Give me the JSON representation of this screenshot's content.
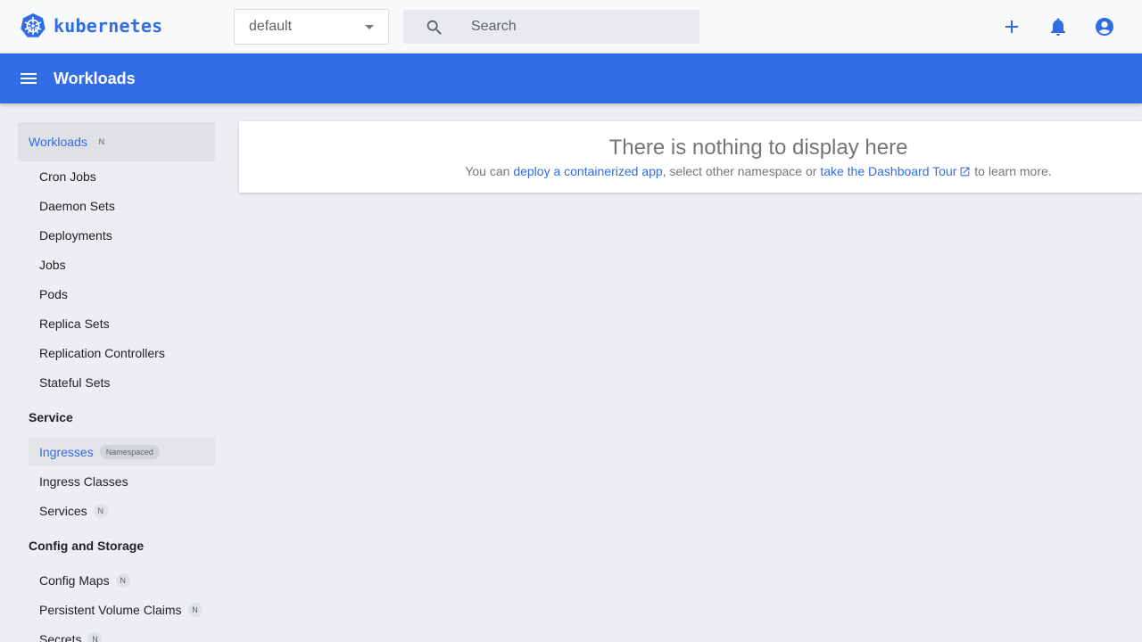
{
  "app": {
    "name": "kubernetes",
    "brand_color": "#326ce5"
  },
  "header": {
    "namespace": {
      "selected": "default"
    },
    "search": {
      "placeholder": "Search"
    },
    "icons": [
      "search-icon",
      "plus-icon",
      "bell-icon",
      "account-circle-icon"
    ]
  },
  "toolbar": {
    "title": "Workloads",
    "icon": "menu-icon"
  },
  "sidebar": {
    "workloads_header": {
      "label": "Workloads",
      "badge": "N"
    },
    "workloads_items": [
      {
        "label": "Cron Jobs"
      },
      {
        "label": "Daemon Sets"
      },
      {
        "label": "Deployments"
      },
      {
        "label": "Jobs"
      },
      {
        "label": "Pods"
      },
      {
        "label": "Replica Sets"
      },
      {
        "label": "Replication Controllers"
      },
      {
        "label": "Stateful Sets"
      }
    ],
    "service_section": "Service",
    "service_items": [
      {
        "label": "Ingresses",
        "badge": "Namespaced",
        "active": true
      },
      {
        "label": "Ingress Classes"
      },
      {
        "label": "Services",
        "badge": "N"
      }
    ],
    "config_section": "Config and Storage",
    "config_items": [
      {
        "label": "Config Maps",
        "badge": "N"
      },
      {
        "label": "Persistent Volume Claims",
        "badge": "N"
      },
      {
        "label": "Secrets",
        "badge": "N"
      }
    ]
  },
  "main": {
    "empty_title": "There is nothing to display here",
    "empty_prefix": "You can ",
    "deploy_link": "deploy a containerized app",
    "empty_middle": ", select other namespace or ",
    "tour_link": "take the Dashboard Tour",
    "empty_suffix": " to learn more."
  }
}
